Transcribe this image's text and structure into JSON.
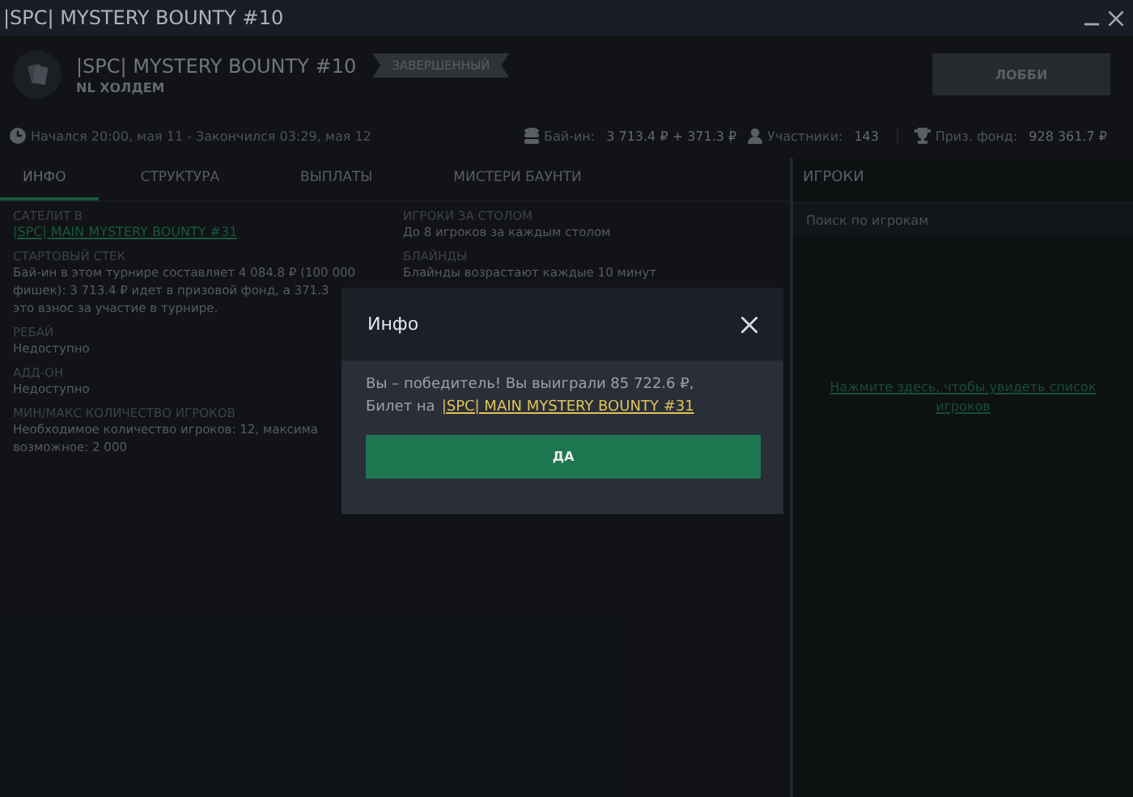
{
  "window": {
    "title": "|SPC| MYSTERY BOUNTY  #10"
  },
  "header": {
    "title": "|SPC| MYSTERY BOUNTY  #10",
    "game": "NL ХОЛДЕМ",
    "status": "ЗАВЕРШЕННЫЙ",
    "lobby_button": "ЛОББИ"
  },
  "info_bar": [
    {
      "kind": "time",
      "label": "Начался 20:00, мая 11  -  Закончился 03:29, мая 12"
    },
    {
      "kind": "buyin",
      "label": "Бай-ин:",
      "value": "3 713.4 ₽ + 371.3 ₽"
    },
    {
      "kind": "players",
      "label": "Участники:",
      "value": "143"
    },
    {
      "kind": "prize",
      "label": "Приз. фонд:",
      "value": "928 361.7 ₽"
    }
  ],
  "tabs": [
    {
      "label": "ИНФО",
      "selected": true
    },
    {
      "label": "СТРУКТУРА",
      "selected": false
    },
    {
      "label": "ВЫПЛАТЫ",
      "selected": false
    },
    {
      "label": "МИСТЕРИ БАУНТИ",
      "selected": false
    }
  ],
  "info_columns": [
    [
      {
        "heading": "САТЕЛИТ В",
        "kind": "link",
        "lines": [
          "|SPC| MAIN MYSTERY BOUNTY  #31"
        ]
      },
      {
        "heading": "СТАРТОВЫЙ СТЕК",
        "kind": "text",
        "lines": [
          "Бай-ин в этом турнире составляет 4 084.8 ₽ (100 000",
          "фишек): 3 713.4 ₽ идет в призовой фонд, а 371.3",
          "это взнос за участие в турнире."
        ]
      },
      {
        "heading": "РЕБАЙ",
        "kind": "text",
        "lines": [
          "Недоступно"
        ]
      },
      {
        "heading": "АДД-ОН",
        "kind": "text",
        "lines": [
          "Недоступно"
        ]
      },
      {
        "heading": "МИН/МАКС КОЛИЧЕСТВО ИГРОКОВ",
        "kind": "text",
        "lines": [
          "Необходимое количество игроков: 12, максима",
          "возможное: 2 000"
        ]
      }
    ],
    [
      {
        "heading": "ИГРОКИ ЗА СТОЛОМ",
        "kind": "text",
        "lines": [
          "До 8 игроков за каждым столом"
        ]
      },
      {
        "heading": "БЛАЙНДЫ",
        "kind": "text",
        "lines": [
          "Блайнды возрастают каждые 10 минут"
        ]
      }
    ]
  ],
  "players_panel": {
    "title": "ИГРОКИ",
    "search": {
      "placeholder": "Поиск по игрокам"
    },
    "link": "Нажмите здесь, чтобы увидеть список игроков"
  },
  "dialog": {
    "title": "Инфо",
    "message": "Вы – победитель! Вы выиграли 85 722.6 ₽,",
    "ticket_prefix": "Билет на",
    "ticket_link": "|SPC| MAIN MYSTERY BOUNTY #31",
    "button": "ДА"
  }
}
